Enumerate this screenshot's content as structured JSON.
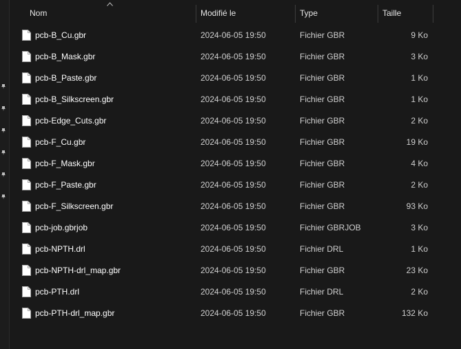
{
  "columns": {
    "name": "Nom",
    "modified": "Modifié le",
    "type": "Type",
    "size": "Taille"
  },
  "files": [
    {
      "name": "pcb-B_Cu.gbr",
      "modified": "2024-06-05 19:50",
      "type": "Fichier GBR",
      "size": "9 Ko"
    },
    {
      "name": "pcb-B_Mask.gbr",
      "modified": "2024-06-05 19:50",
      "type": "Fichier GBR",
      "size": "3 Ko"
    },
    {
      "name": "pcb-B_Paste.gbr",
      "modified": "2024-06-05 19:50",
      "type": "Fichier GBR",
      "size": "1 Ko"
    },
    {
      "name": "pcb-B_Silkscreen.gbr",
      "modified": "2024-06-05 19:50",
      "type": "Fichier GBR",
      "size": "1 Ko"
    },
    {
      "name": "pcb-Edge_Cuts.gbr",
      "modified": "2024-06-05 19:50",
      "type": "Fichier GBR",
      "size": "2 Ko"
    },
    {
      "name": "pcb-F_Cu.gbr",
      "modified": "2024-06-05 19:50",
      "type": "Fichier GBR",
      "size": "19 Ko"
    },
    {
      "name": "pcb-F_Mask.gbr",
      "modified": "2024-06-05 19:50",
      "type": "Fichier GBR",
      "size": "4 Ko"
    },
    {
      "name": "pcb-F_Paste.gbr",
      "modified": "2024-06-05 19:50",
      "type": "Fichier GBR",
      "size": "2 Ko"
    },
    {
      "name": "pcb-F_Silkscreen.gbr",
      "modified": "2024-06-05 19:50",
      "type": "Fichier GBR",
      "size": "93 Ko"
    },
    {
      "name": "pcb-job.gbrjob",
      "modified": "2024-06-05 19:50",
      "type": "Fichier GBRJOB",
      "size": "3 Ko"
    },
    {
      "name": "pcb-NPTH.drl",
      "modified": "2024-06-05 19:50",
      "type": "Fichier DRL",
      "size": "1 Ko"
    },
    {
      "name": "pcb-NPTH-drl_map.gbr",
      "modified": "2024-06-05 19:50",
      "type": "Fichier GBR",
      "size": "23 Ko"
    },
    {
      "name": "pcb-PTH.drl",
      "modified": "2024-06-05 19:50",
      "type": "Fichier DRL",
      "size": "2 Ko"
    },
    {
      "name": "pcb-PTH-drl_map.gbr",
      "modified": "2024-06-05 19:50",
      "type": "Fichier GBR",
      "size": "132 Ko"
    }
  ],
  "icons": {
    "file": "file-icon",
    "pin": "pin-icon",
    "sort": "sort-ascending-icon"
  },
  "colors": {
    "background": "#191919",
    "separator": "#3d3d3d",
    "text_primary": "#ffffff",
    "text_secondary": "#d0d0d0"
  }
}
